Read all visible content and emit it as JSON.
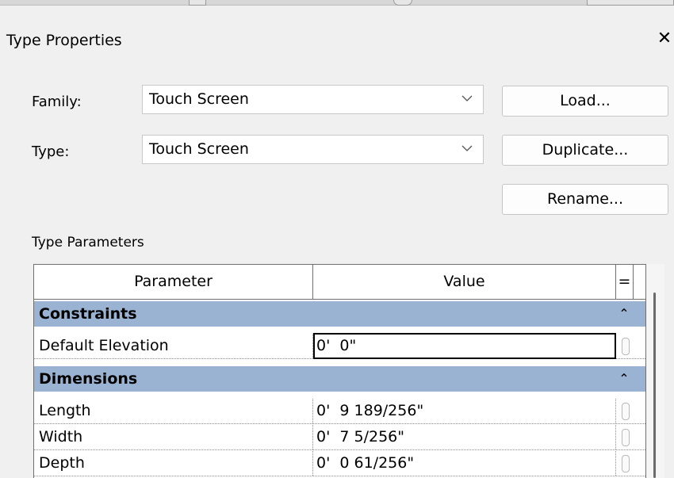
{
  "window": {
    "title": "Type Properties",
    "close_glyph": "✕"
  },
  "family": {
    "label": "Family:",
    "value": "Touch Screen"
  },
  "type": {
    "label": "Type:",
    "value": "Touch Screen"
  },
  "buttons": {
    "load": "Load...",
    "duplicate": "Duplicate...",
    "rename": "Rename..."
  },
  "type_parameters": {
    "label": "Type Parameters",
    "columns": {
      "parameter": "Parameter",
      "value": "Value",
      "formula": "="
    },
    "groups": [
      {
        "name": "Constraints",
        "collapse_glyph": "⌃",
        "rows": [
          {
            "name": "Default Elevation",
            "value": "0'  0\""
          }
        ]
      },
      {
        "name": "Dimensions",
        "collapse_glyph": "⌃",
        "rows": [
          {
            "name": "Length",
            "value": "0'  9 189/256\""
          },
          {
            "name": "Width",
            "value": "0'  7 5/256\""
          },
          {
            "name": "Depth",
            "value": "0'  0 61/256\""
          }
        ]
      }
    ]
  },
  "colors": {
    "group_header": "#9ab3d2",
    "dialog_bg": "#f0f0f0",
    "grid_border": "#6f6f6f"
  }
}
